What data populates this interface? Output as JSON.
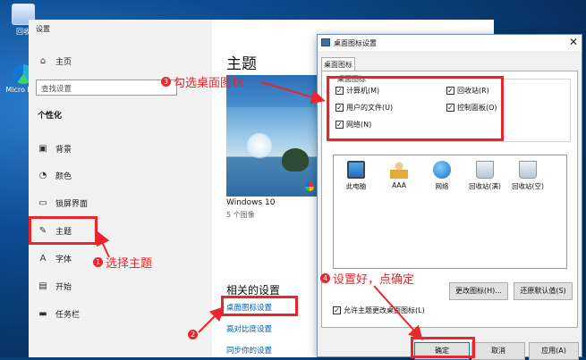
{
  "desktop": {
    "icons": [
      {
        "label": "回收",
        "icon": "recycle-bin-icon"
      },
      {
        "label": "Micro Edg",
        "icon": "edge-icon"
      }
    ]
  },
  "settings": {
    "window_title": "设置",
    "home_label": "主页",
    "search_placeholder": "查找设置",
    "section": "个性化",
    "nav": [
      {
        "label": "背景",
        "icon": "image-icon"
      },
      {
        "label": "颜色",
        "icon": "palette-icon"
      },
      {
        "label": "锁屏界面",
        "icon": "lock-screen-icon"
      },
      {
        "label": "主题",
        "icon": "brush-icon",
        "selected": true
      },
      {
        "label": "字体",
        "icon": "font-icon"
      },
      {
        "label": "开始",
        "icon": "start-icon"
      },
      {
        "label": "任务栏",
        "icon": "taskbar-icon"
      }
    ],
    "page_title": "主题",
    "theme_name": "Windows 10",
    "theme_sub": "5 个图像",
    "related_title": "相关的设置",
    "links": [
      "桌面图标设置",
      "高对比度设置",
      "同步你的设置"
    ]
  },
  "dialog": {
    "title": "桌面图标设置",
    "tab": "桌面图标",
    "group_label": "桌面图标",
    "checkboxes": [
      {
        "label": "计算机(M)",
        "checked": true
      },
      {
        "label": "回收站(R)",
        "checked": true
      },
      {
        "label": "用户的文件(U)",
        "checked": true
      },
      {
        "label": "控制面板(O)",
        "checked": true
      },
      {
        "label": "网络(N)",
        "checked": true
      }
    ],
    "icons": [
      {
        "label": "此电脑",
        "icon": "computer-icon"
      },
      {
        "label": "AAA",
        "icon": "user-folder-icon"
      },
      {
        "label": "网络",
        "icon": "network-icon"
      },
      {
        "label": "回收站(满)",
        "icon": "recycle-bin-full-icon"
      },
      {
        "label": "回收站(空)",
        "icon": "recycle-bin-empty-icon"
      }
    ],
    "change_icon_button": "更改图标(H)...",
    "restore_default_button": "还原默认值(S)",
    "allow_theme_label": "允许主题更改桌面图标(L)",
    "allow_theme_checked": true,
    "ok_button": "确定",
    "cancel_button": "取消",
    "apply_button": "应用(A)"
  },
  "annotations": [
    {
      "num": "1",
      "text": "选择主题"
    },
    {
      "num": "2",
      "text": ""
    },
    {
      "num": "3",
      "text": "勾选桌面图标"
    },
    {
      "num": "4",
      "text": "设置好，点确定"
    }
  ],
  "colors": {
    "annotation": "#e8262b",
    "link": "#0062b8",
    "accent": "#0078d7"
  }
}
